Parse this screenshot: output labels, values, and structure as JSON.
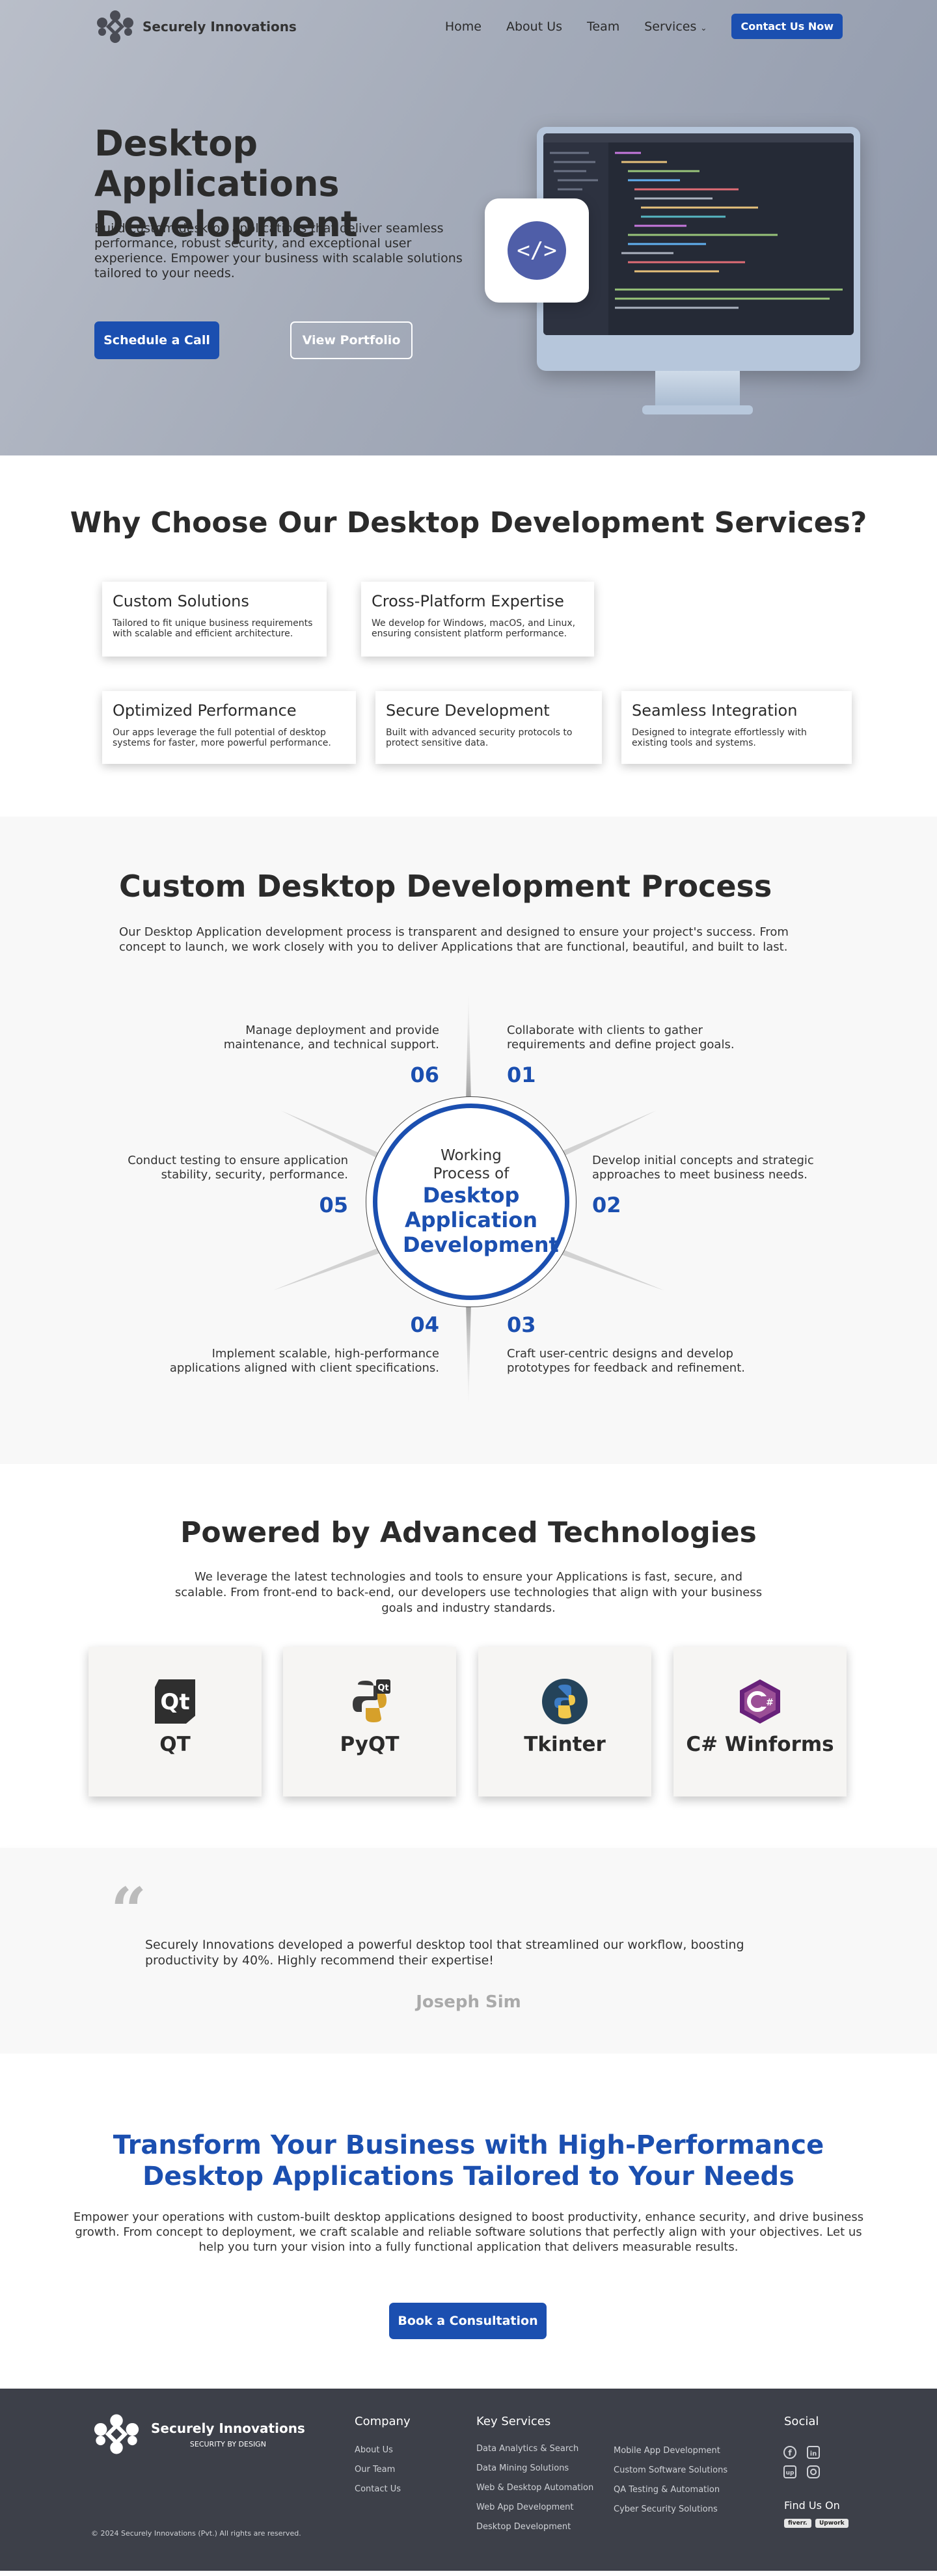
{
  "brand": {
    "name": "Securely Innovations",
    "tagline": "SECURITY BY DESIGN"
  },
  "nav": {
    "items": [
      "Home",
      "About Us",
      "Team",
      "Services"
    ],
    "cta": "Contact Us Now"
  },
  "hero": {
    "title": "Desktop Applications Development",
    "description": "Build custom desktop applications that deliver seamless performance, robust security, and exceptional user experience. Empower your business with scalable solutions tailored to your needs.",
    "primary_button": "Schedule a Call",
    "secondary_button": "View Portfolio",
    "badge_symbol": "</>"
  },
  "why": {
    "title": "Why Choose Our Desktop Development Services?",
    "cards": [
      {
        "title": "Custom Solutions",
        "desc": "Tailored to fit unique business requirements with scalable and efficient architecture."
      },
      {
        "title": "Cross-Platform Expertise",
        "desc": "We develop for Windows, macOS, and Linux, ensuring consistent platform performance."
      },
      {
        "title": "Optimized Performance",
        "desc": "Our apps leverage the full potential of desktop systems for faster, more powerful performance."
      },
      {
        "title": "Secure Development",
        "desc": "Built with advanced security protocols to protect sensitive data."
      },
      {
        "title": "Seamless Integration",
        "desc": "Designed to integrate effortlessly with existing tools and systems."
      }
    ]
  },
  "process": {
    "title": "Custom Desktop Development Process",
    "description": "Our Desktop Application  development process is transparent and designed to ensure your project's success. From concept to launch, we work closely with you to deliver Applications that are functional, beautiful, and built to last.",
    "center_small": "Working Process of",
    "center_big": "Desktop Application Development",
    "steps": [
      {
        "num": "01",
        "text": "Collaborate with clients to gather requirements and define project goals."
      },
      {
        "num": "02",
        "text": "Develop initial concepts and strategic approaches to meet business needs."
      },
      {
        "num": "03",
        "text": "Craft user-centric designs and develop prototypes for feedback and refinement."
      },
      {
        "num": "04",
        "text": "Implement scalable, high-performance applications aligned with client specifications."
      },
      {
        "num": "05",
        "text": "Conduct  testing to ensure application stability, security, performance."
      },
      {
        "num": "06",
        "text": "Manage deployment and provide maintenance, and technical support."
      }
    ]
  },
  "tech": {
    "title": "Powered by Advanced Technologies",
    "description": "We leverage the latest technologies and tools to ensure your Applications is fast, secure, and scalable. From front-end to back-end, our developers use technologies that align with your business goals and industry standards.",
    "items": [
      {
        "label": "QT",
        "icon": "qt-icon"
      },
      {
        "label": "PyQT",
        "icon": "pyqt-icon"
      },
      {
        "label": "Tkinter",
        "icon": "python-icon"
      },
      {
        "label": "C# Winforms",
        "icon": "csharp-icon"
      }
    ]
  },
  "testimonial": {
    "quote": "Securely Innovations developed a powerful desktop tool that streamlined our workflow, boosting productivity by 40%. Highly recommend their expertise!",
    "author": "Joseph Sim"
  },
  "cta": {
    "title": "Transform Your Business with High-Performance Desktop Applications Tailored to Your Needs",
    "description": "Empower your operations with custom-built desktop applications designed to boost productivity, enhance security, and drive business growth. From concept to deployment, we craft scalable and reliable software solutions that perfectly align with your objectives. Let us help you turn your vision into a fully functional application that delivers measurable results.",
    "button": "Book a Consultation"
  },
  "footer": {
    "company_heading": "Company",
    "company_links": [
      "About Us",
      "Our Team",
      "Contact Us"
    ],
    "services_heading": "Key Services",
    "services_col1": [
      "Data Analytics & Search",
      "Data Mining Solutions",
      "Web & Desktop Automation",
      "Web App Development",
      "Desktop Development"
    ],
    "services_col2": [
      "Mobile App Development",
      "Custom Software Solutions",
      "QA Testing & Automation",
      "Cyber Security Solutions"
    ],
    "social_heading": "Social",
    "find_us": "Find Us On",
    "badges": [
      "fiverr.",
      "Upwork"
    ],
    "copyright": "© 2024 Securely Innovations (Pvt.) All rights are reserved."
  },
  "colors": {
    "accent": "#1b4fb0",
    "footer_bg": "#3d4049",
    "section_alt_bg": "#f8f8f8"
  }
}
